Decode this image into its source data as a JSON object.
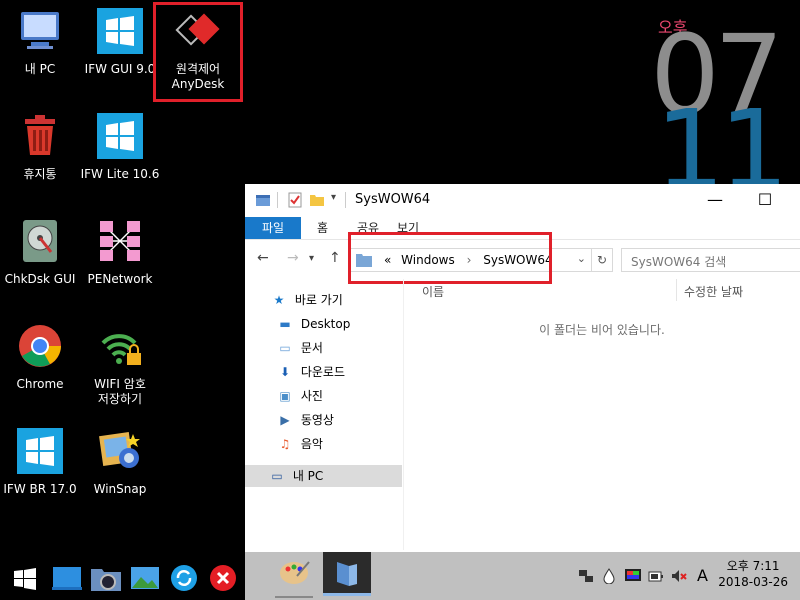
{
  "desktop": {
    "icons": [
      {
        "label": "내 PC",
        "icon": "monitor-icon"
      },
      {
        "label": "IFW GUI 9.0",
        "icon": "windows-logo-icon"
      },
      {
        "label": "원격제어\nAnyDesk",
        "icon": "anydesk-icon"
      },
      {
        "label": "휴지통",
        "icon": "recycle-bin-icon"
      },
      {
        "label": "IFW Lite 10.6",
        "icon": "windows-logo-icon"
      },
      {
        "label": "ChkDsk GUI",
        "icon": "disk-check-icon"
      },
      {
        "label": "PENetwork",
        "icon": "network-icon"
      },
      {
        "label": "Chrome",
        "icon": "chrome-icon"
      },
      {
        "label": "WIFI 암호\n저장하기",
        "icon": "wifi-lock-icon"
      },
      {
        "label": "IFW BR 17.0",
        "icon": "windows-logo-icon"
      },
      {
        "label": "WinSnap",
        "icon": "winsnap-icon"
      }
    ]
  },
  "clock": {
    "ampm": "오후",
    "hour": "07",
    "minute": "11"
  },
  "explorer": {
    "title": "SysWOW64",
    "ribbon_tabs": [
      "파일",
      "홈",
      "공유",
      "보기"
    ],
    "address": {
      "prefix": "«",
      "segments": [
        "Windows",
        "SysWOW64"
      ]
    },
    "search_placeholder": "SysWOW64 검색",
    "nav": {
      "quick_access": "바로 가기",
      "items": [
        "Desktop",
        "문서",
        "다운로드",
        "사진",
        "동영상",
        "음악"
      ],
      "this_pc": "내 PC"
    },
    "columns": [
      "이름",
      "수정한 날짜"
    ],
    "empty_message": "이 폴더는 비어 있습니다."
  },
  "taskbar": {
    "time": "오후 7:11",
    "date": "2018-03-26",
    "ime": "A"
  },
  "colors": {
    "accent": "#1979ca",
    "highlight": "#e0202a"
  }
}
